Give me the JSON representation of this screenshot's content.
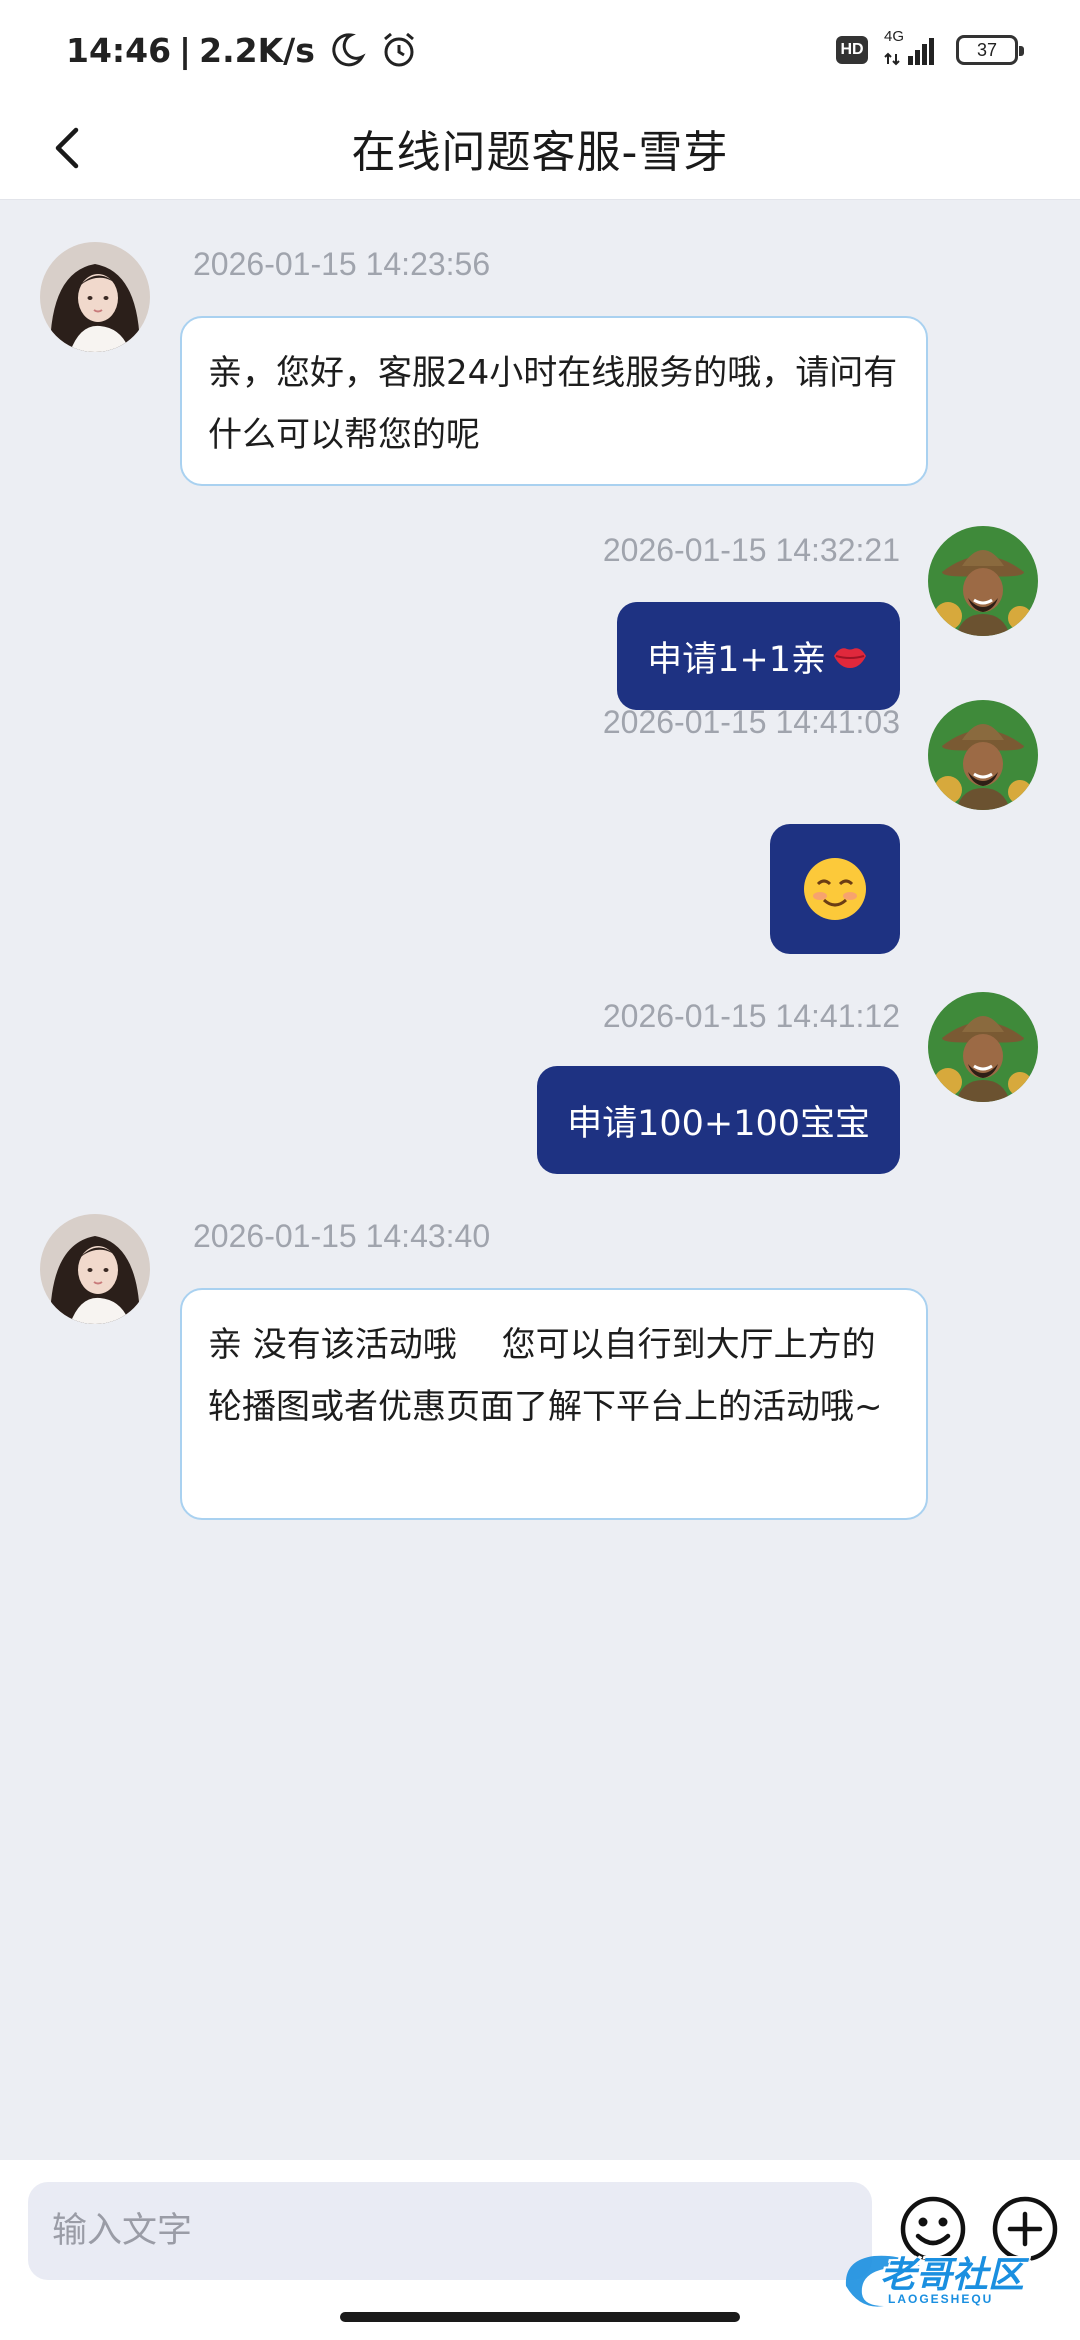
{
  "status_bar": {
    "time": "14:46",
    "separator": "|",
    "net_speed": "2.2K/s",
    "signal_type": "4G",
    "hd_label": "HD",
    "battery": "37",
    "icons": [
      "moon-icon",
      "alarm-icon",
      "signal-icon",
      "battery-icon"
    ]
  },
  "header": {
    "title": "在线问题客服-雪芽",
    "back_icon": "chevron-left-icon"
  },
  "messages": [
    {
      "side": "agent",
      "timestamp": "2026-01-15 14:23:56",
      "text": "亲，您好，客服24小时在线服务的哦，请问有什么可以帮您的呢"
    },
    {
      "side": "user",
      "timestamp": "2026-01-15 14:32:21",
      "text": "申请1+1亲",
      "emoji": "kiss-lips"
    },
    {
      "side": "user",
      "timestamp": "2026-01-15 14:41:03",
      "emoji": "smiling-face-blush"
    },
    {
      "side": "user",
      "timestamp": "2026-01-15 14:41:12",
      "text": "申请100+100宝宝"
    },
    {
      "side": "agent",
      "timestamp": "2026-01-15 14:43:40",
      "text": "亲 没有该活动哦　 您可以自行到大厅上方的轮播图或者优惠页面了解下平台上的活动哦~"
    }
  ],
  "input_bar": {
    "placeholder": "输入文字",
    "emoji_icon": "smiley-icon",
    "plus_icon": "plus-circle-icon"
  },
  "watermark": {
    "text": "老哥社区",
    "sub": "LAOGESHEQU"
  },
  "colors": {
    "background": "#eceef3",
    "user_bubble": "#1e3282",
    "agent_bubble_border": "#a9d1f0",
    "timestamp": "#a0a4ad"
  }
}
